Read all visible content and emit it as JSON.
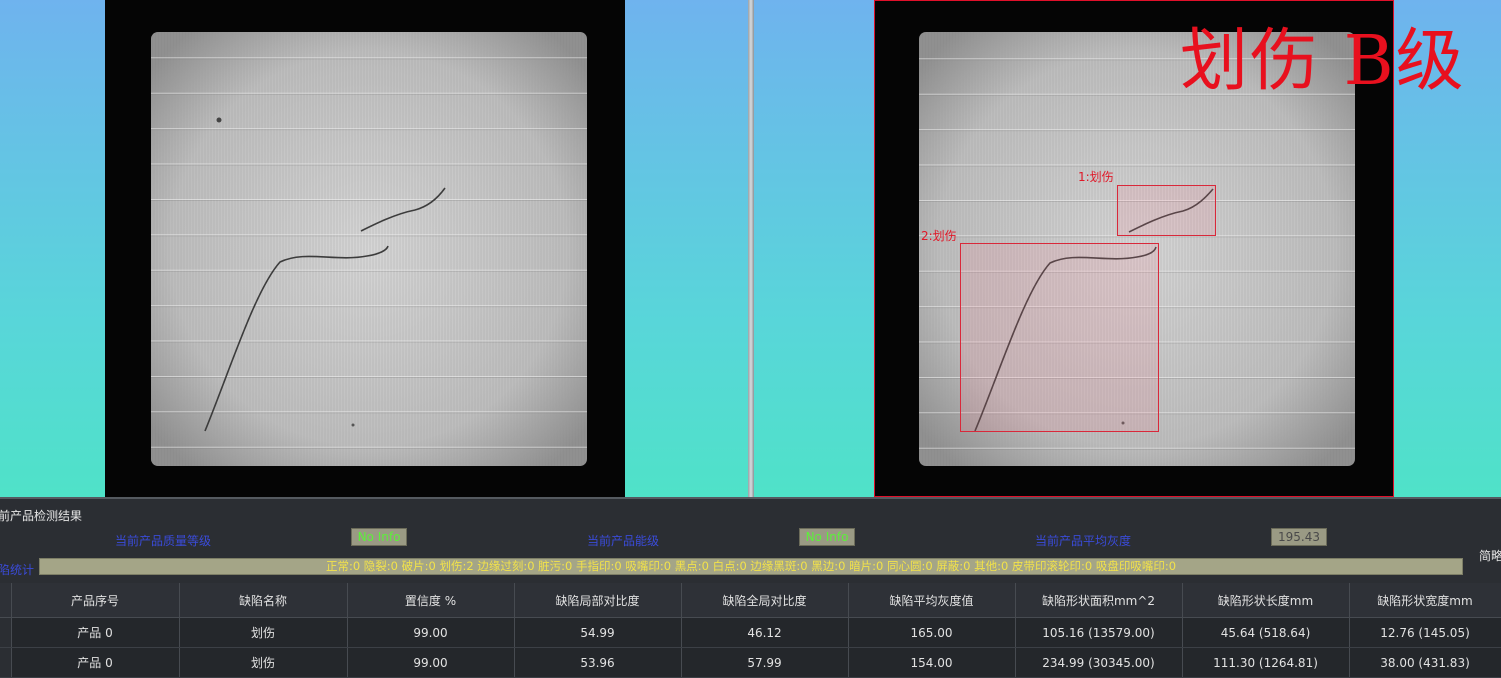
{
  "overlay": {
    "grade_text": "划伤  B级",
    "defects": [
      {
        "label": "1:划伤"
      },
      {
        "label": "2:划伤"
      }
    ]
  },
  "result_panel": {
    "title": "前产品检测结果",
    "quality_grade_label": "当前产品质量等级",
    "quality_grade_value": "No Info",
    "energy_grade_label": "当前产品能级",
    "energy_grade_value": "No Info",
    "avg_gray_label": "当前产品平均灰度",
    "avg_gray_value": "195.43",
    "stats_label": "陷统计",
    "stats_text": "正常:0 隐裂:0 破片:0 划伤:2 边缘过刻:0 脏污:0 手指印:0 吸嘴印:0 黑点:0 白点:0 边缘黑斑:0 黑边:0 暗片:0 同心圆:0 屏蔽:0 其他:0 皮带印滚轮印:0 吸盘印吸嘴印:0",
    "side_label": "简略"
  },
  "table": {
    "columns": [
      "产品序号",
      "缺陷名称",
      "置信度 %",
      "缺陷局部对比度",
      "缺陷全局对比度",
      "缺陷平均灰度值",
      "缺陷形状面积mm^2",
      "缺陷形状长度mm",
      "缺陷形状宽度mm"
    ],
    "rows": [
      [
        "产品 0",
        "划伤",
        "99.00",
        "54.99",
        "46.12",
        "165.00",
        "105.16 (13579.00)",
        "45.64 (518.64)",
        "12.76 (145.05)"
      ],
      [
        "产品 0",
        "划伤",
        "99.00",
        "53.96",
        "57.99",
        "154.00",
        "234.99 (30345.00)",
        "111.30 (1264.81)",
        "38.00 (431.83)"
      ]
    ]
  },
  "colors": {
    "defect_red": "#e01828",
    "value_green": "#5cf03a",
    "stats_yellow": "#f2e24a",
    "label_blue": "#3a4bd8"
  }
}
